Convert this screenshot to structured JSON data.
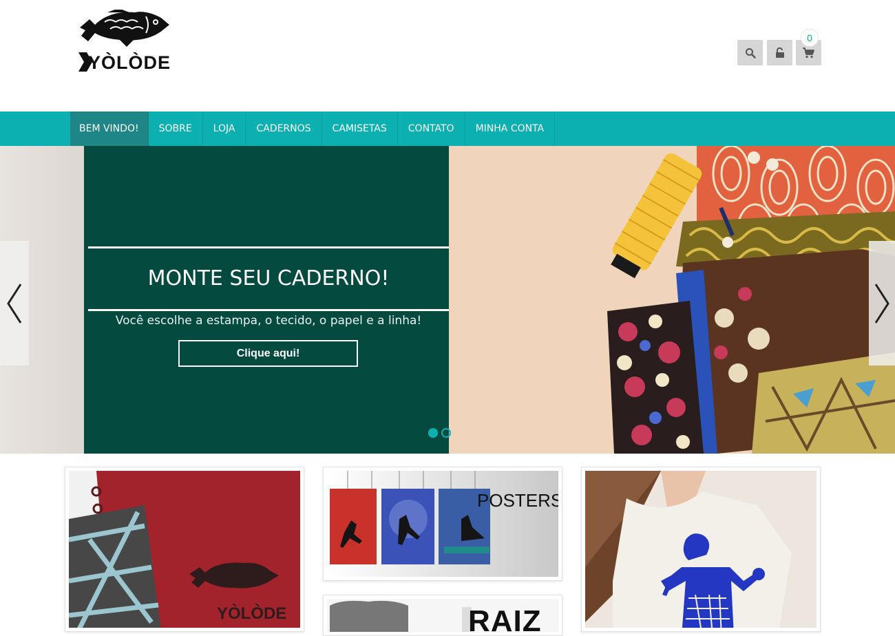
{
  "brand": {
    "logo_alt": "Yòlòde",
    "logo_text": "YÒLÒDE"
  },
  "header_actions": {
    "search_icon": "search-icon",
    "login_icon": "unlock-icon",
    "cart_icon": "cart-icon",
    "cart_count": "0"
  },
  "nav": {
    "items": [
      {
        "label": "BEM VINDO!",
        "active": true
      },
      {
        "label": "SOBRE",
        "active": false
      },
      {
        "label": "LOJA",
        "active": false
      },
      {
        "label": "CADERNOS",
        "active": false
      },
      {
        "label": "CAMISETAS",
        "active": false
      },
      {
        "label": "CONTATO",
        "active": false
      },
      {
        "label": "MINHA CONTA",
        "active": false
      }
    ]
  },
  "slider": {
    "title": "MONTE SEU CADERNO!",
    "subtitle": "Você escolhe a estampa, o tecido, o papel e a linha!",
    "cta_label": "Clique aqui!",
    "prev_icon": "chevron-left-icon",
    "next_icon": "chevron-right-icon",
    "dots": 2,
    "active_dot": 1
  },
  "cards": {
    "posters_label": "POSTERS",
    "raiz_label": "RAIZ",
    "notebook_logo_text": "YÒLÒDE"
  },
  "colors": {
    "accent": "#0db0b0",
    "nav_active": "#1e8686",
    "slide_panel": "#044a3f",
    "button_gray": "#d6d6d6"
  }
}
